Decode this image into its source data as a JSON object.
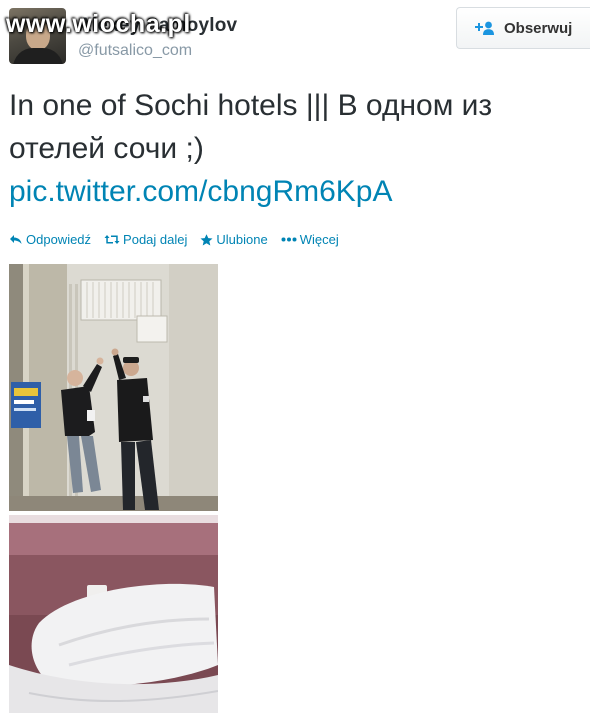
{
  "header": {
    "watermark": "www.wiocha.pl",
    "name": "Alexey Samoylov",
    "handle": "@futsalico_com",
    "follow_label": "Obserwuj"
  },
  "tweet": {
    "text": "In one of Sochi hotels ||| В одном из отелей сочи ;)",
    "link": "pic.twitter.com/cbngRm6KpA"
  },
  "actions": {
    "reply": "Odpowiedź",
    "retweet": "Podaj dalej",
    "favorite": "Ulubione",
    "more": "Więcej"
  },
  "colors": {
    "link": "#0084b4",
    "text": "#292f33",
    "muted": "#8899a6"
  },
  "icons": [
    "add-user-icon",
    "reply-icon",
    "retweet-icon",
    "star-icon",
    "more-dots-icon"
  ]
}
